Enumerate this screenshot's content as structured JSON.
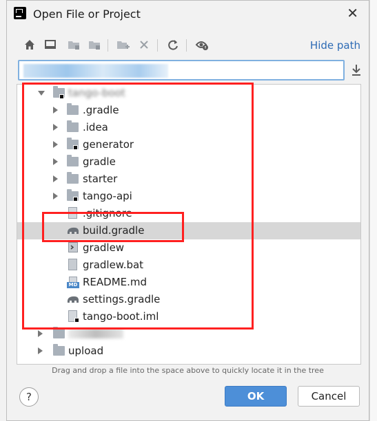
{
  "window": {
    "title": "Open File or Project"
  },
  "toolbar": {
    "hide_path_label": "Hide path",
    "buttons": [
      "home-icon",
      "desktop-icon",
      "project-folder-icon",
      "module-folder-icon",
      "new-folder-icon",
      "delete-icon",
      "refresh-icon",
      "show-hidden-icon"
    ]
  },
  "path_field": {
    "value": ""
  },
  "tree": {
    "root": {
      "label": "tango-boot",
      "expanded": true
    },
    "items": [
      {
        "label": ".gradle",
        "type": "folder",
        "expandable": true
      },
      {
        "label": ".idea",
        "type": "folder",
        "expandable": true
      },
      {
        "label": "generator",
        "type": "module-folder",
        "expandable": true
      },
      {
        "label": "gradle",
        "type": "folder",
        "expandable": true
      },
      {
        "label": "starter",
        "type": "folder",
        "expandable": true
      },
      {
        "label": "tango-api",
        "type": "module-folder",
        "expandable": true
      },
      {
        "label": ".gitignore",
        "type": "ignore-file",
        "expandable": false
      },
      {
        "label": "build.gradle",
        "type": "gradle-file",
        "expandable": false,
        "selected": true
      },
      {
        "label": "gradlew",
        "type": "shell-file",
        "expandable": false
      },
      {
        "label": "gradlew.bat",
        "type": "bat-file",
        "expandable": false
      },
      {
        "label": "README.md",
        "type": "markdown-file",
        "expandable": false
      },
      {
        "label": "settings.gradle",
        "type": "gradle-file",
        "expandable": false
      },
      {
        "label": "tango-boot.iml",
        "type": "iml-file",
        "expandable": false
      }
    ],
    "siblings_after": [
      {
        "label": "",
        "type": "folder"
      },
      {
        "label": "upload",
        "type": "folder"
      }
    ]
  },
  "hint": "Drag and drop a file into the space above to quickly locate it in the tree",
  "buttons": {
    "help": "?",
    "ok": "OK",
    "cancel": "Cancel"
  },
  "colors": {
    "accent": "#4d8fd8",
    "annotation": "#ff2020",
    "link": "#2d6bb5",
    "selection": "#d7d7d7"
  }
}
